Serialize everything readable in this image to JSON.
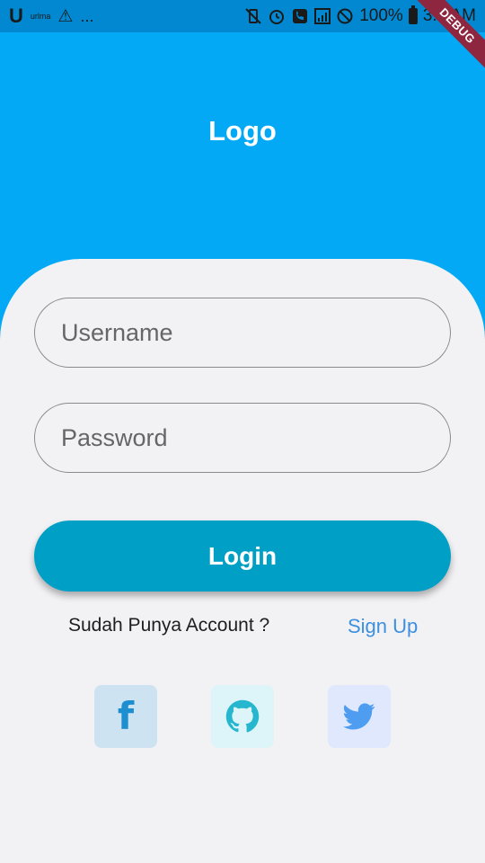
{
  "status_bar": {
    "left_icon": "U",
    "app_label": "urlma",
    "warning_icon": "warning-icon",
    "more": "...",
    "battery_text": "100%",
    "time": "3:0 AM"
  },
  "debug_banner": "DEBUG",
  "header": {
    "logo_text": "Logo"
  },
  "form": {
    "username_placeholder": "Username",
    "password_placeholder": "Password",
    "login_label": "Login"
  },
  "signup_row": {
    "prompt": "Sudah Punya Account ?",
    "link": "Sign Up"
  },
  "social": [
    {
      "name": "facebook",
      "icon": "facebook-icon",
      "color": "#1d8fd1"
    },
    {
      "name": "github",
      "icon": "github-icon",
      "color": "#26b7cf"
    },
    {
      "name": "twitter",
      "icon": "twitter-icon",
      "color": "#4f9df0"
    }
  ],
  "colors": {
    "primary": "#03a9f4",
    "button": "#00a0c6",
    "card": "#f2f2f5",
    "link": "#3d8fe0"
  }
}
